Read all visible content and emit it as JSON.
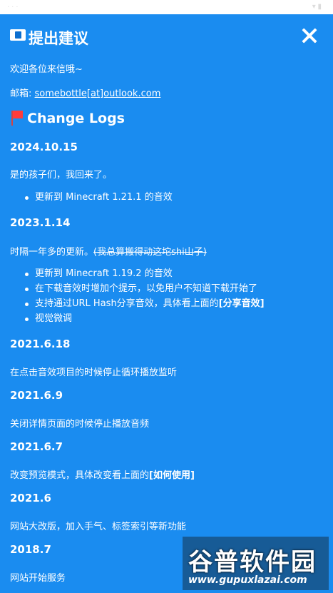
{
  "dialog": {
    "title": "提出建议",
    "welcome": "欢迎各位来信哦~",
    "email_label": "邮箱: ",
    "email_value": "somebottle[at]outlook.com"
  },
  "changelog": {
    "heading": "Change Logs",
    "entries": [
      {
        "version": "2024.10.15",
        "desc": "是的孩子们，我回来了。",
        "bullets": [
          "更新到 Minecraft 1.21.1 的音效"
        ]
      },
      {
        "version": "2023.1.14",
        "desc_plain": "时隔一年多的更新。",
        "desc_strike": "(我总算搬得动这坨shi山子)",
        "bullets": [
          "更新到 Minecraft 1.19.2 的音效",
          "在下载音效时增加个提示，以免用户不知道下载开始了",
          "支持通过URL Hash分享音效，具体看上面的",
          "视觉微调"
        ],
        "bullet3_bold": "[分享音效]"
      },
      {
        "version": "2021.6.18",
        "desc": "在点击音效项目的时候停止循环播放监听"
      },
      {
        "version": "2021.6.9",
        "desc": "关闭详情页面的时候停止播放音频"
      },
      {
        "version": "2021.6.7",
        "desc": "改变预览模式，具体改变看上面的",
        "desc_bold": "[如何使用]"
      },
      {
        "version": "2021.6",
        "desc": "网站大改版，加入手气、标签索引等新功能"
      },
      {
        "version": "2018.7",
        "desc": "网站开始服务"
      }
    ]
  },
  "watermark": {
    "title": "谷普软件园",
    "url": "www.gupuxlazai.com"
  },
  "colors": {
    "background": "#1a8cf0",
    "text": "#ffffff"
  }
}
